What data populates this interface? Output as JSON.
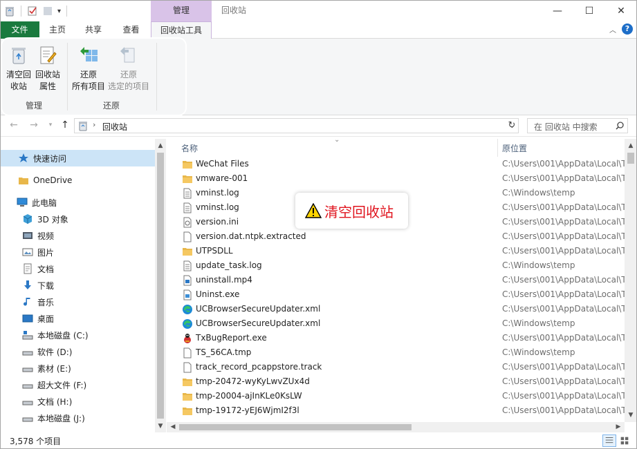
{
  "titlebar": {
    "context_tab_header": "管理",
    "window_title": "回收站",
    "controls": {
      "minimize": "—",
      "maximize": "☐",
      "close": "✕"
    }
  },
  "ribbon": {
    "tabs": [
      "文件",
      "主页",
      "共享",
      "查看",
      "回收站工具"
    ],
    "help": "?",
    "groups": {
      "manage": {
        "label": "管理",
        "empty_bin": "清空回\n收站",
        "properties": "回收站\n属性"
      },
      "restore": {
        "label": "还原",
        "restore_all": "还原\n所有项目",
        "restore_selected": "还原\n选定的项目"
      }
    }
  },
  "address": {
    "path": "回收站",
    "search_placeholder": "在 回收站 中搜索"
  },
  "nav": {
    "quick_access": "快速访问",
    "onedrive": "OneDrive",
    "this_pc": "此电脑",
    "items": [
      {
        "label": "3D 对象",
        "icon": "3d-objects-icon"
      },
      {
        "label": "视频",
        "icon": "videos-icon"
      },
      {
        "label": "图片",
        "icon": "pictures-icon"
      },
      {
        "label": "文档",
        "icon": "documents-icon"
      },
      {
        "label": "下载",
        "icon": "downloads-icon"
      },
      {
        "label": "音乐",
        "icon": "music-icon"
      },
      {
        "label": "桌面",
        "icon": "desktop-icon"
      },
      {
        "label": "本地磁盘 (C:)",
        "icon": "drive-icon"
      },
      {
        "label": "软件 (D:)",
        "icon": "drive-icon"
      },
      {
        "label": "素材 (E:)",
        "icon": "drive-icon"
      },
      {
        "label": "超大文件 (F:)",
        "icon": "drive-icon"
      },
      {
        "label": "文档 (H:)",
        "icon": "drive-icon"
      },
      {
        "label": "本地磁盘 (J:)",
        "icon": "drive-icon"
      }
    ]
  },
  "list": {
    "columns": {
      "name": "名称",
      "location": "原位置"
    },
    "rows": [
      {
        "name": "WeChat Files",
        "location": "C:\\Users\\001\\AppData\\Local\\T",
        "type": "folder"
      },
      {
        "name": "vmware-001",
        "location": "C:\\Users\\001\\AppData\\Local\\T",
        "type": "folder"
      },
      {
        "name": "vminst.log",
        "location": "C:\\Windows\\temp",
        "type": "text"
      },
      {
        "name": "vminst.log",
        "location": "C:\\Users\\001\\AppData\\Local\\T",
        "type": "text"
      },
      {
        "name": "version.ini",
        "location": "C:\\Users\\001\\AppData\\Local\\T",
        "type": "ini"
      },
      {
        "name": "version.dat.ntpk.extracted",
        "location": "C:\\Users\\001\\AppData\\Local\\T",
        "type": "blank"
      },
      {
        "name": "UTPSDLL",
        "location": "C:\\Users\\001\\AppData\\Local\\T",
        "type": "folder"
      },
      {
        "name": "update_task.log",
        "location": "C:\\Windows\\temp",
        "type": "text"
      },
      {
        "name": "uninstall.mp4",
        "location": "C:\\Users\\001\\AppData\\Local\\T",
        "type": "video"
      },
      {
        "name": "Uninst.exe",
        "location": "C:\\Users\\001\\AppData\\Local\\T",
        "type": "exe"
      },
      {
        "name": "UCBrowserSecureUpdater.xml",
        "location": "C:\\Users\\001\\AppData\\Local\\T",
        "type": "edge"
      },
      {
        "name": "UCBrowserSecureUpdater.xml",
        "location": "C:\\Windows\\temp",
        "type": "edge"
      },
      {
        "name": "TxBugReport.exe",
        "location": "C:\\Users\\001\\AppData\\Local\\T",
        "type": "bug"
      },
      {
        "name": "TS_56CA.tmp",
        "location": "C:\\Windows\\temp",
        "type": "blank"
      },
      {
        "name": "track_record_pcappstore.track",
        "location": "C:\\Users\\001\\AppData\\Local\\T",
        "type": "blank"
      },
      {
        "name": "tmp-20472-wyKyLwvZUx4d",
        "location": "C:\\Users\\001\\AppData\\Local\\T",
        "type": "folder"
      },
      {
        "name": "tmp-20004-ajInKLe0KsLW",
        "location": "C:\\Users\\001\\AppData\\Local\\T",
        "type": "folder"
      },
      {
        "name": "tmp-19172-yEJ6WjmI2f3l",
        "location": "C:\\Users\\001\\AppData\\Local\\T",
        "type": "folder"
      }
    ]
  },
  "status": {
    "count": "3,578 个项目"
  },
  "callout": {
    "text": "清空回收站"
  },
  "colors": {
    "file_tab": "#1a7a3e",
    "context_tab": "#d9c3e8",
    "selection": "#cce4f7",
    "callout_text": "#e0141e"
  }
}
